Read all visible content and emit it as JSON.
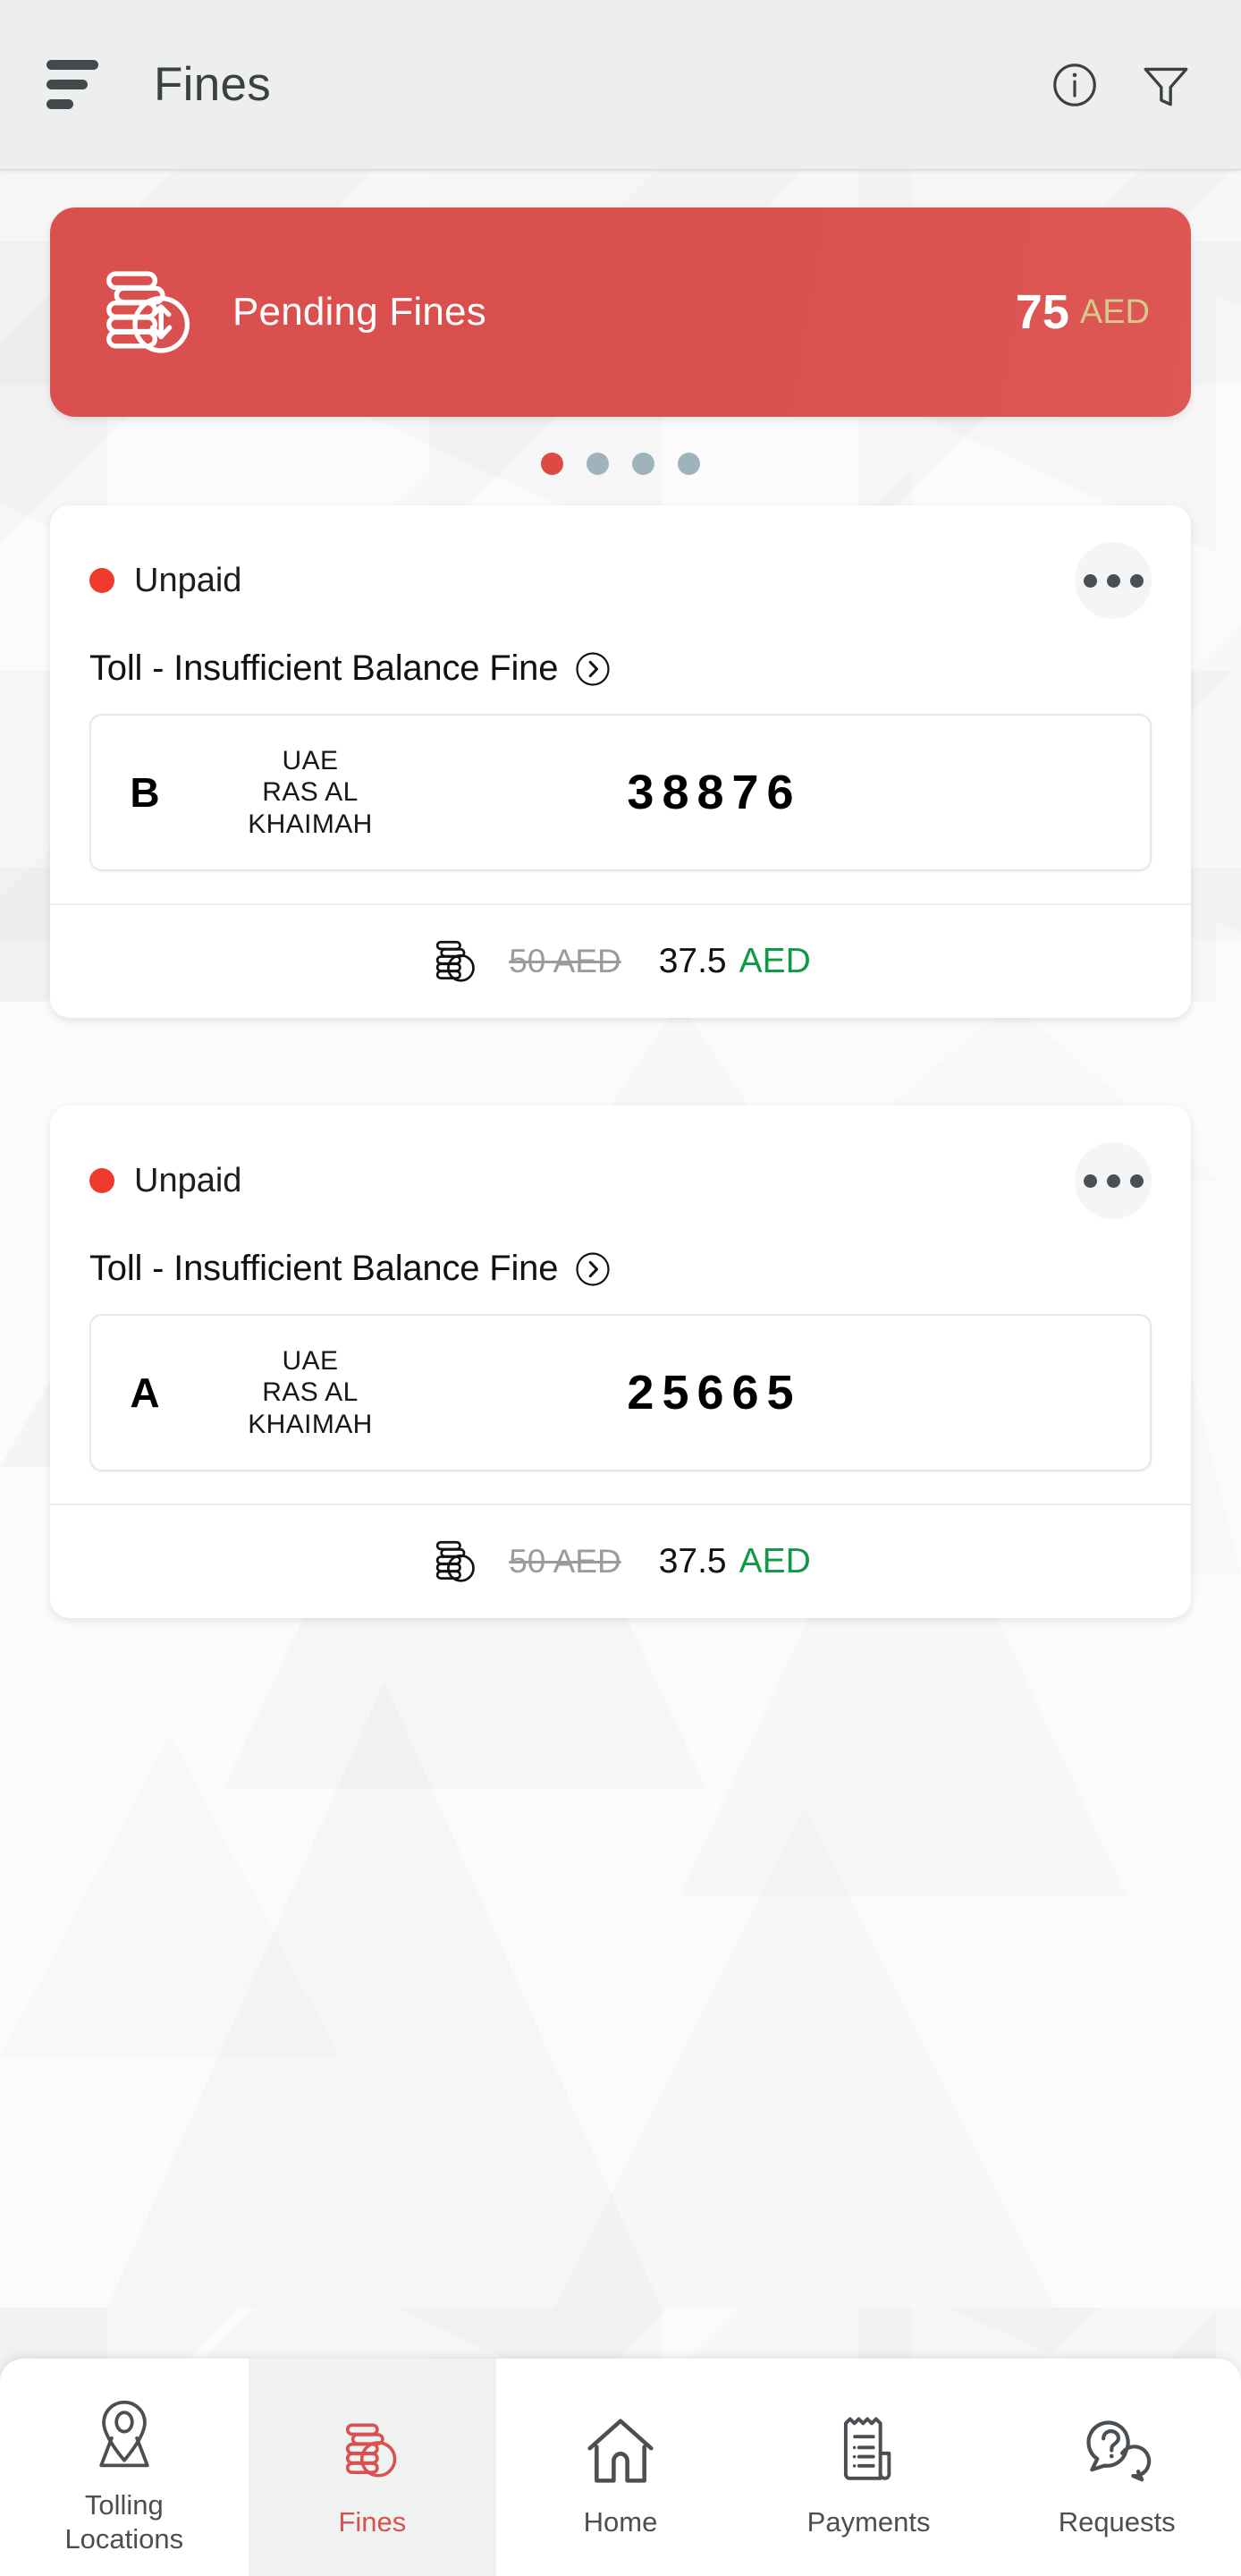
{
  "header": {
    "title": "Fines",
    "menu_icon": "hamburger-menu-icon",
    "info_icon": "info-circle-icon",
    "filter_icon": "filter-funnel-icon"
  },
  "banner": {
    "label": "Pending Fines",
    "amount": "75",
    "currency": "AED",
    "icon": "coins-exchange-icon",
    "bg_color": "#d9504e",
    "currency_color": "#d6c98a"
  },
  "pagination": {
    "total": 4,
    "active_index": 0,
    "active_color": "#dc4a44",
    "inactive_color": "#9fb3bd"
  },
  "fines": [
    {
      "status": "Unpaid",
      "status_color": "#ef3b2d",
      "title": "Toll - Insufficient Balance Fine",
      "more_icon": "more-options-icon",
      "chevron_icon": "chevron-right-circle-icon",
      "plate": {
        "letter": "B",
        "country": "UAE",
        "emirate_line1": "RAS AL",
        "emirate_line2": "KHAIMAH",
        "number": "38876"
      },
      "price": {
        "icon": "coins-icon",
        "original": "50 AED",
        "discounted": "37.5",
        "currency": "AED",
        "currency_color": "#0f9a46"
      }
    },
    {
      "status": "Unpaid",
      "status_color": "#ef3b2d",
      "title": "Toll - Insufficient Balance Fine",
      "more_icon": "more-options-icon",
      "chevron_icon": "chevron-right-circle-icon",
      "plate": {
        "letter": "A",
        "country": "UAE",
        "emirate_line1": "RAS AL",
        "emirate_line2": "KHAIMAH",
        "number": "25665"
      },
      "price": {
        "icon": "coins-icon",
        "original": "50 AED",
        "discounted": "37.5",
        "currency": "AED",
        "currency_color": "#0f9a46"
      }
    }
  ],
  "bottom_nav": {
    "active_index": 1,
    "active_color": "#d9504e",
    "items": [
      {
        "label_line1": "Tolling",
        "label_line2": "Locations",
        "icon": "map-pin-icon"
      },
      {
        "label_line1": "Fines",
        "label_line2": "",
        "icon": "coins-icon"
      },
      {
        "label_line1": "Home",
        "label_line2": "",
        "icon": "home-icon"
      },
      {
        "label_line1": "Payments",
        "label_line2": "",
        "icon": "receipt-icon"
      },
      {
        "label_line1": "Requests",
        "label_line2": "",
        "icon": "question-chat-icon"
      }
    ]
  }
}
